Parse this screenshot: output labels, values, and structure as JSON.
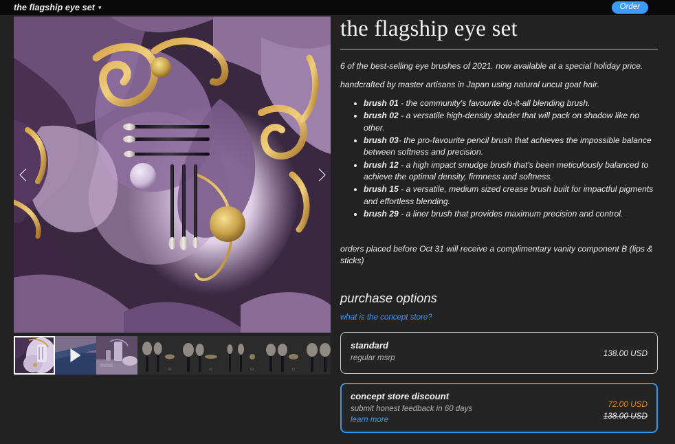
{
  "topbar": {
    "title": "the flagship eye set",
    "chevron_icon": "chevron-down-icon",
    "order_label": "Order",
    "accent": "#3b9bfb",
    "background": "#0a0a0a"
  },
  "gallery": {
    "prev_label": "Previous image",
    "next_label": "Next image",
    "prev_icon": "chevron-left-icon",
    "next_icon": "chevron-right-icon",
    "thumbnails": [
      {
        "label": "set closeup",
        "type": "image",
        "selected": true
      },
      {
        "label": "product video",
        "type": "video",
        "selected": false
      },
      {
        "label": "vanity scene",
        "type": "image",
        "selected": false
      },
      {
        "label": "brush 01",
        "type": "image",
        "selected": false
      },
      {
        "label": "brush 02",
        "type": "image",
        "selected": false
      },
      {
        "label": "brush 03",
        "type": "image",
        "selected": false
      },
      {
        "label": "brush 12",
        "type": "image",
        "selected": false
      },
      {
        "label": "brush 15",
        "type": "image",
        "selected": false
      }
    ]
  },
  "product": {
    "title": "the flagship eye set",
    "intro_1": "6 of the best-selling eye brushes of 2021. now available at a special holiday price.",
    "intro_2": "handcrafted by master artisans in Japan using natural uncut goat hair.",
    "brushes": [
      {
        "name": "brush 01",
        "desc": " - the community's favourite do-it-all blending brush."
      },
      {
        "name": "brush 02",
        "desc": " - a versatile high-density shader that will pack on shadow like no other."
      },
      {
        "name": "brush 03",
        "desc": "- the pro-favourite pencil brush that achieves the impossible balance between softness and precision."
      },
      {
        "name": "brush 12",
        "desc": " - a high impact smudge brush that's been meticulously balanced to achieve the optimal density, firmness and softness."
      },
      {
        "name": "brush 15",
        "desc": " - a versatile, medium sized crease brush built for impactful pigments and effortless blending."
      },
      {
        "name": "brush 29",
        "desc": " - a liner brush that provides maximum precision and control."
      }
    ],
    "promo": "orders placed before Oct 31 will receive a complimentary vanity component B (lips & sticks)"
  },
  "purchase": {
    "heading": "purchase options",
    "concept_store_link": "what is the concept store?",
    "options": [
      {
        "name": "standard",
        "sub": "regular msrp",
        "price": "138.00 USD",
        "original_price": null,
        "link": null,
        "selected": false
      },
      {
        "name": "concept store discount",
        "sub": "submit honest feedback in 60 days",
        "price": "72.00 USD",
        "original_price": "138.00 USD",
        "link": "learn more",
        "selected": true
      }
    ],
    "selected_border_color": "#2e9bf0",
    "discount_price_color": "#e0892b"
  }
}
